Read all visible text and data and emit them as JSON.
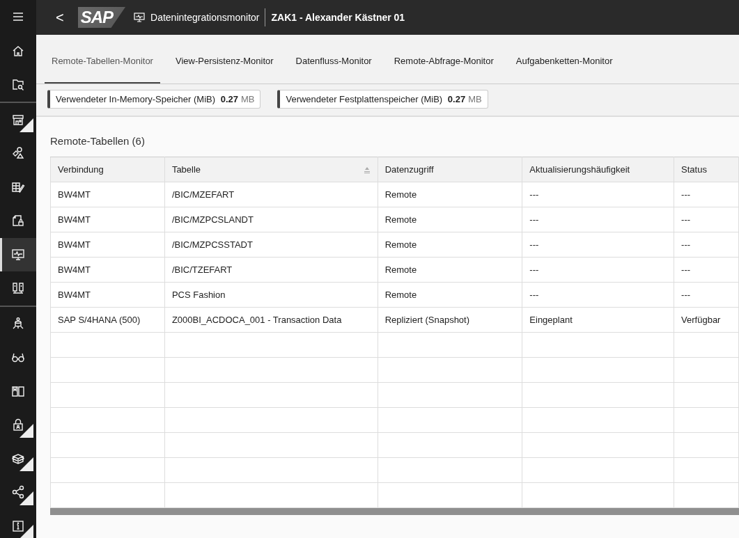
{
  "sidebar": {
    "groups": [
      [
        {
          "kind": "menu",
          "selected": false,
          "expandable": false
        },
        {
          "kind": "home",
          "selected": false,
          "expandable": false
        },
        {
          "kind": "folder-search",
          "selected": false,
          "expandable": false
        }
      ],
      [
        {
          "kind": "store",
          "selected": false,
          "expandable": true
        },
        {
          "kind": "shapes",
          "selected": false,
          "expandable": false
        },
        {
          "kind": "table-edit",
          "selected": false,
          "expandable": false
        },
        {
          "kind": "file-lock",
          "selected": false,
          "expandable": false
        },
        {
          "kind": "monitor",
          "selected": true,
          "expandable": false
        },
        {
          "kind": "servers",
          "selected": false,
          "expandable": false
        }
      ],
      [
        {
          "kind": "database-person",
          "selected": false,
          "expandable": false
        },
        {
          "kind": "glasses",
          "selected": false,
          "expandable": false
        },
        {
          "kind": "book",
          "selected": false,
          "expandable": false
        },
        {
          "kind": "lock",
          "selected": false,
          "expandable": true
        },
        {
          "kind": "box",
          "selected": false,
          "expandable": true
        },
        {
          "kind": "share",
          "selected": false,
          "expandable": true
        },
        {
          "kind": "info",
          "selected": false,
          "expandable": true
        }
      ]
    ]
  },
  "header": {
    "back": "<",
    "logo": "SAP",
    "app_title": "Datenintegrationsmonitor",
    "space": "ZAK1 - Alexander Kästner 01"
  },
  "tabs": [
    {
      "label": "Remote-Tabellen-Monitor",
      "selected": true
    },
    {
      "label": "View-Persistenz-Monitor",
      "selected": false
    },
    {
      "label": "Datenfluss-Monitor",
      "selected": false
    },
    {
      "label": "Remote-Abfrage-Monitor",
      "selected": false
    },
    {
      "label": "Aufgabenketten-Monitor",
      "selected": false
    }
  ],
  "metrics": [
    {
      "label": "Verwendeter In-Memory-Speicher (MiB)",
      "value": "0.27",
      "unit": "MB"
    },
    {
      "label": "Verwendeter Festplattenspeicher (MiB)",
      "value": "0.27",
      "unit": "MB"
    }
  ],
  "table": {
    "title": "Remote-Tabellen (6)",
    "columns": [
      {
        "label": "Verbindung",
        "sorted": false
      },
      {
        "label": "Tabelle",
        "sorted": true
      },
      {
        "label": "Datenzugriff",
        "sorted": false
      },
      {
        "label": "Aktualisierungshäufigkeit",
        "sorted": false
      },
      {
        "label": "Status",
        "sorted": false
      }
    ],
    "rows": [
      [
        "BW4MT",
        "/BIC/MZEFART",
        "Remote",
        "---",
        "---"
      ],
      [
        "BW4MT",
        "/BIC/MZPCSLANDT",
        "Remote",
        "---",
        "---"
      ],
      [
        "BW4MT",
        "/BIC/MZPCSSTADT",
        "Remote",
        "---",
        "---"
      ],
      [
        "BW4MT",
        "/BIC/TZEFART",
        "Remote",
        "---",
        "---"
      ],
      [
        "BW4MT",
        "PCS Fashion",
        "Remote",
        "---",
        "---"
      ],
      [
        "SAP S/4HANA (500)",
        "Z000BI_ACDOCA_001 - Transaction Data",
        "Repliziert (Snapshot)",
        "Eingeplant",
        "Verfügbar"
      ]
    ]
  }
}
